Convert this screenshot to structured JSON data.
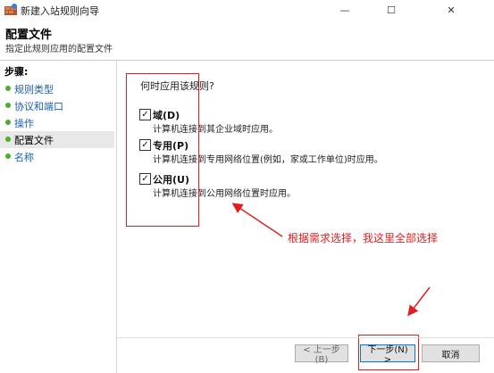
{
  "window": {
    "title": "新建入站规则向导",
    "minimize_glyph": "—",
    "maximize_glyph": "☐",
    "close_glyph": "✕"
  },
  "header": {
    "title": "配置文件",
    "subtitle": "指定此规则应用的配置文件"
  },
  "sidebar": {
    "steps_label": "步骤:",
    "items": [
      {
        "label": "规则类型",
        "current": false
      },
      {
        "label": "协议和端口",
        "current": false
      },
      {
        "label": "操作",
        "current": false
      },
      {
        "label": "配置文件",
        "current": true
      },
      {
        "label": "名称",
        "current": false
      }
    ]
  },
  "main": {
    "question": "何时应用该规则?",
    "options": [
      {
        "label": "域(D)",
        "description": "计算机连接到其企业域时应用。",
        "checked": true
      },
      {
        "label": "专用(P)",
        "description": "计算机连接到专用网络位置(例如，家或工作单位)时应用。",
        "checked": true
      },
      {
        "label": "公用(U)",
        "description": "计算机连接到公用网络位置时应用。",
        "checked": true
      }
    ],
    "checkmark_glyph": "✓"
  },
  "annotation": {
    "text": "根据需求选择，我这里全部选择",
    "color": "#e02020"
  },
  "footer": {
    "back_label": "< 上一步(B)",
    "next_label": "下一步(N) >",
    "cancel_label": "取消"
  },
  "colors": {
    "step_link": "#1a5fb4",
    "step_dot": "#4caf2a",
    "annotation_red": "#e02020",
    "focus_blue": "#0078d7"
  }
}
